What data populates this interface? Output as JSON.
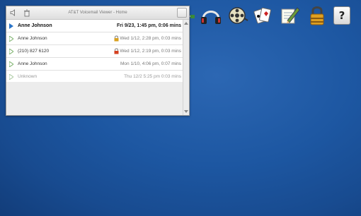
{
  "window": {
    "title": "AT&T Voicemail Viewer - Home"
  },
  "voicemails": [
    {
      "name": "Anne Johnson",
      "date": "Fri 9/23, 1:45 pm, 0:06 mins",
      "status": "new",
      "locked": false,
      "locked_color": ""
    },
    {
      "name": "Anne Johnson",
      "date": "Wed 1/12, 2:28 pm, 0:03 mins",
      "status": "read",
      "locked": true,
      "locked_color": "#d8a020"
    },
    {
      "name": "(210) 827 6120",
      "date": "Wed 1/12, 2:19 pm, 0:03 mins",
      "status": "read",
      "locked": true,
      "locked_color": "#d44020"
    },
    {
      "name": "Anne Johnson",
      "date": "Mon 1/10, 4:06 pm, 0:07 mins",
      "status": "read",
      "locked": false,
      "locked_color": ""
    },
    {
      "name": "Unknown",
      "date": "Thu 12/2 5:25 pm  0:03 mins",
      "status": "old",
      "locked": false,
      "locked_color": ""
    }
  ],
  "dock": {
    "icons": [
      "network-icon",
      "headphones-icon",
      "film-reel-icon",
      "playing-cards-icon",
      "notepad-pencil-icon",
      "padlock-icon",
      "help-icon"
    ],
    "help_label": "?"
  },
  "colors": {
    "desktop": "#1d57a2",
    "play_new": "#2a74c8",
    "play_read": "#7ab06a"
  }
}
